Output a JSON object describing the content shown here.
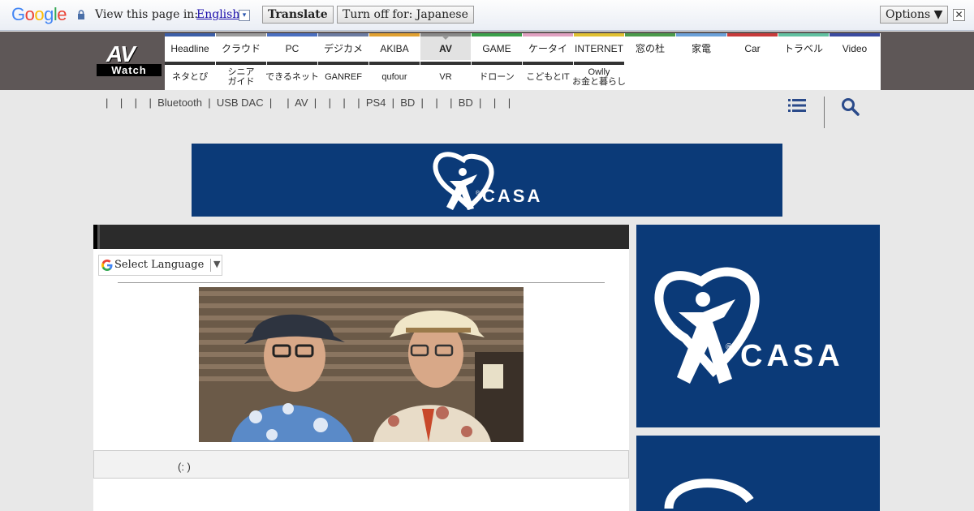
{
  "translate_bar": {
    "logo": "Google",
    "prompt": "View this page in:",
    "language": "English",
    "dropdown_glyph": "▾",
    "translate_label": "Translate",
    "turn_off_label": "Turn off for: Japanese",
    "options_label": "Options ▼",
    "close_glyph": "✕"
  },
  "site": {
    "logo_top": "AV",
    "logo_bottom": "Watch"
  },
  "nav": {
    "row1": [
      "Headline",
      "クラウド",
      "PC",
      "デジカメ",
      "AKIBA",
      "AV",
      "GAME",
      "ケータイ",
      "INTERNET",
      "窓の杜",
      "家電",
      "Car",
      "トラベル",
      "Video"
    ],
    "row1_colors": [
      "#3b5ea8",
      "#9a9a9a",
      "#4a6fc0",
      "#6a7aa0",
      "#e0a030",
      "#888888",
      "#3aa04a",
      "#e0a0c0",
      "#e0c030",
      "#4a9a4a",
      "#6aa0d8",
      "#c83a3a",
      "#60c0a0",
      "#3a4aa0"
    ],
    "row2": [
      "ネタとぴ",
      "シニア\nガイド",
      "できるネット",
      "GANREF",
      "qufour",
      "VR",
      "ドローン",
      "こどもとIT",
      "Owlly\nお金と暮らし"
    ],
    "active": "AV"
  },
  "subnav": {
    "text": "|    |    |    |  Bluetooth  |  USB DAC  |     |  AV  |    |    |    |  PS4  |  BD  |    |    |  BD  |    |    |"
  },
  "ads": {
    "brand": "CASA",
    "registered": "®"
  },
  "article": {
    "select_language": "Select Language",
    "select_arrow": "▼",
    "caption": "(:    )"
  }
}
